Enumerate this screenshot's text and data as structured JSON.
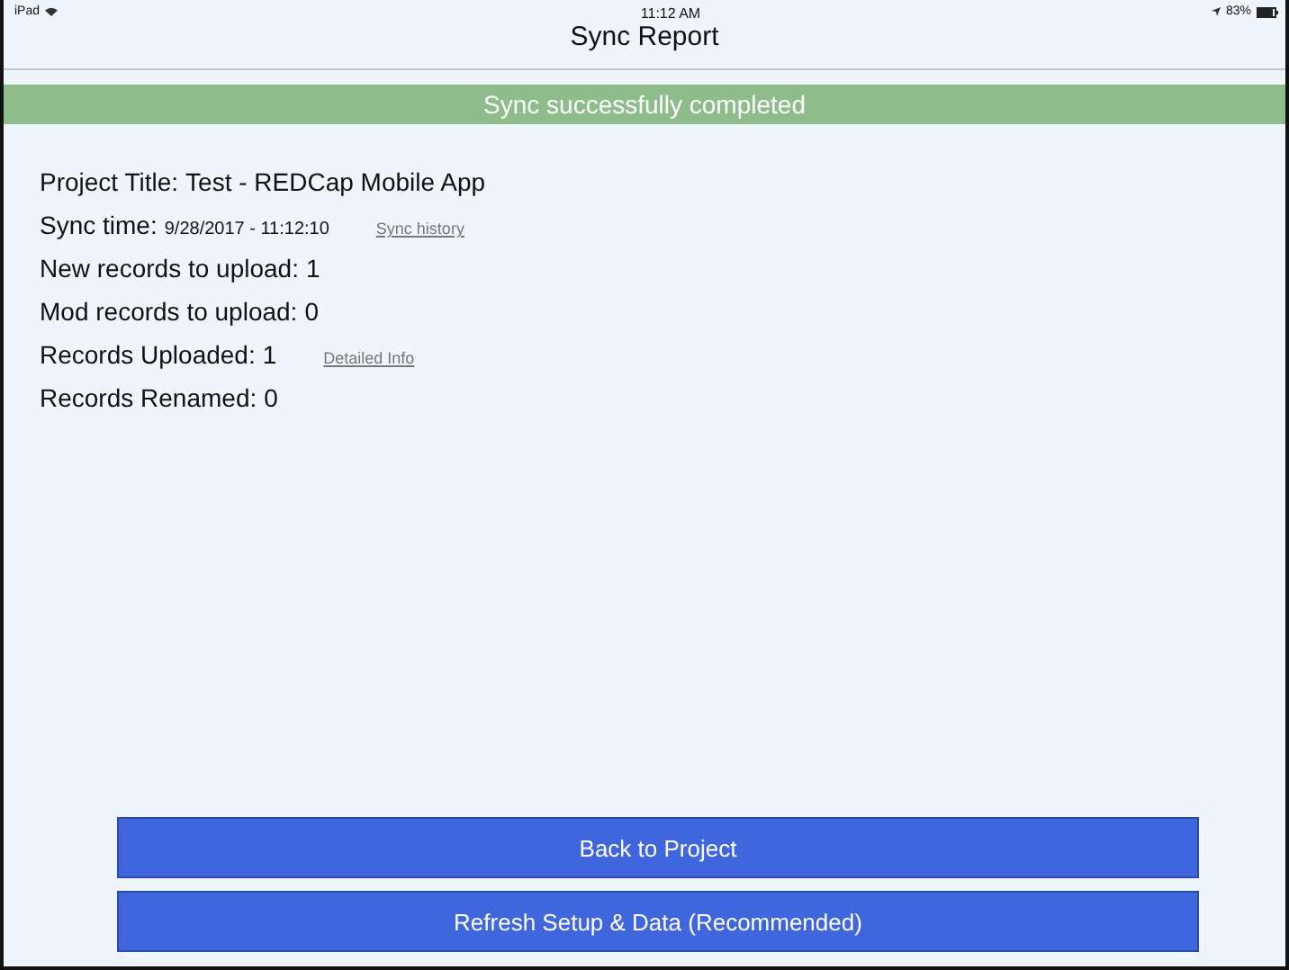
{
  "status_bar": {
    "device": "iPad",
    "time": "11:12 AM",
    "battery": "83%"
  },
  "window": {
    "title": "Sync Report"
  },
  "banner": "Sync successfully completed",
  "rows": [
    {
      "kind": "text",
      "label": "Project Title:",
      "value": "Test - REDCap Mobile App"
    },
    {
      "kind": "timestamp",
      "label": "Sync time:",
      "value": "9/28/2017 - 11:12:10",
      "link": "Sync history"
    },
    {
      "kind": "text",
      "label": "New records to upload:",
      "value": "1"
    },
    {
      "kind": "text",
      "label": "Mod records to upload:",
      "value": "0"
    },
    {
      "kind": "text",
      "label": "Records Uploaded:",
      "value": "1",
      "link": "Detailed Info"
    },
    {
      "kind": "text",
      "label": "Records Renamed:",
      "value": "0"
    }
  ],
  "buttons": [
    "Back to Project",
    "Refresh Setup & Data (Recommended)"
  ]
}
